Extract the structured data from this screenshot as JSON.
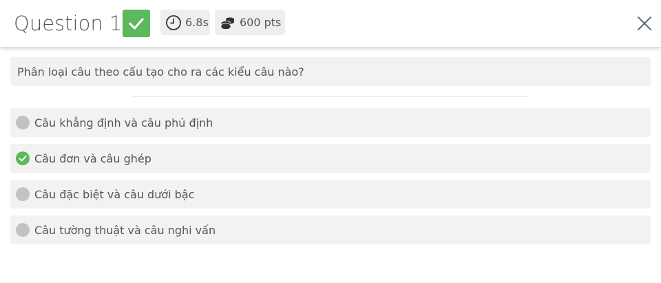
{
  "header": {
    "title": "Question 1",
    "status_icon": "check-icon",
    "status_color": "#5cb85c",
    "time": {
      "icon": "clock-icon",
      "label": "6.8s"
    },
    "points": {
      "icon": "coins-icon",
      "label": "600 pts"
    },
    "close_icon": "close-icon"
  },
  "question": {
    "text": "Phân loại câu theo cấu tạo cho ra các kiểu câu nào?"
  },
  "options": [
    {
      "label": "Câu khẳng định và câu phủ định",
      "state": "neutral"
    },
    {
      "label": "Câu đơn và câu ghép",
      "state": "correct"
    },
    {
      "label": "Câu đặc biệt và câu dưới bậc",
      "state": "neutral"
    },
    {
      "label": "Câu tường thuật và câu nghi vấn",
      "state": "neutral"
    }
  ],
  "colors": {
    "correct": "#5cb85c",
    "neutral": "#c2c2c2",
    "card_background": "#f2f2f2"
  }
}
